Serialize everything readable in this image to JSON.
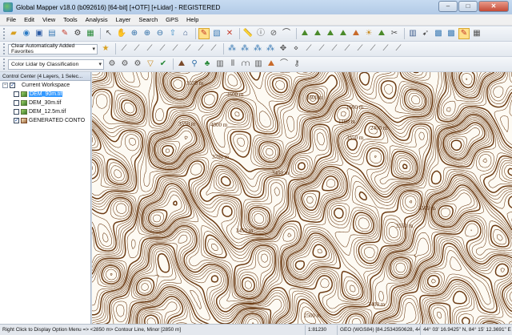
{
  "window": {
    "title": "Global Mapper v18.0 (b092616) [64-bit] [+OTF] [+Lidar] - REGISTERED"
  },
  "menu": [
    "File",
    "Edit",
    "View",
    "Tools",
    "Analysis",
    "Layer",
    "Search",
    "GPS",
    "Help"
  ],
  "toolbar": {
    "feature_combo": "Clear Automatically Added Favorites",
    "lidar_combo": "Color Lidar by Classification"
  },
  "control_center": {
    "header": "Control Center (4 Layers, 1 Selec...",
    "workspace": "Current Workspace",
    "layers": [
      {
        "name": "DEM_90m.tif",
        "checked": false,
        "selected": true
      },
      {
        "name": "DEM_30m.tif",
        "checked": false,
        "selected": false
      },
      {
        "name": "DEM_12.5m.tif",
        "checked": false,
        "selected": false
      },
      {
        "name": "GENERATED CONTO",
        "checked": true,
        "selected": false
      }
    ]
  },
  "map": {
    "line_color": "#6b3a12",
    "labels": [
      "3550 m",
      "3600 m",
      "3500 m",
      "1600 m",
      "3550 m",
      "4000 m",
      "1100 m",
      "3550 m",
      "3700 m",
      "3450 m",
      "2450 m",
      "3500 m",
      "3400 m",
      "2500 m",
      "3550 m",
      "3450 m"
    ]
  },
  "status": {
    "hint": "Right Click to Display Option Menu => <2850 m> Contour Line, Minor [2850 m]",
    "scale": "1:81230",
    "projection": "GEO (WGS84) [84.2534350628, 44.0547062574]",
    "coords": "44° 03' 16.9425\" N, 84° 15' 12.3691\" E"
  }
}
